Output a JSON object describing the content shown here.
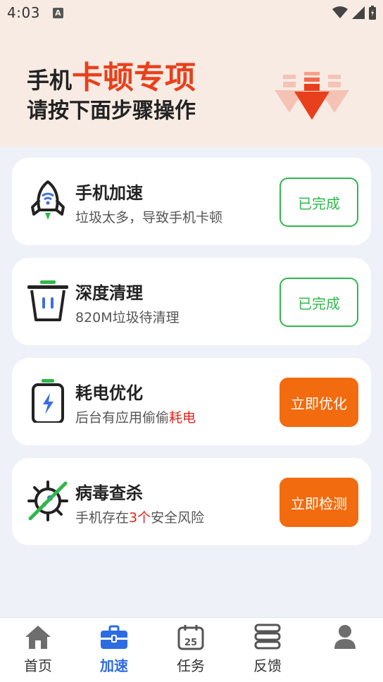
{
  "status_bar": {
    "time": "4:03",
    "notif_letter": "A"
  },
  "hero": {
    "title_prefix": "手机",
    "title_accent": "卡顿专项",
    "subtitle": "请按下面步骤操作"
  },
  "cards": [
    {
      "title": "手机加速",
      "sub_parts": [
        "垃圾太多，导致手机卡顿"
      ],
      "button": "已完成",
      "button_state": "done",
      "icon": "rocket-icon"
    },
    {
      "title": "深度清理",
      "sub_parts": [
        "820M垃圾待清理"
      ],
      "button": "已完成",
      "button_state": "done",
      "icon": "trash-icon"
    },
    {
      "title": "耗电优化",
      "sub_parts": [
        "后台有应用偷偷",
        "耗电"
      ],
      "button": "立即优化",
      "button_state": "action",
      "icon": "battery-icon"
    },
    {
      "title": "病毒查杀",
      "sub_parts": [
        "手机存在",
        "3个",
        "安全风险"
      ],
      "button": "立即检测",
      "button_state": "action",
      "icon": "virus-icon"
    }
  ],
  "tabbar": {
    "items": [
      {
        "label": "首页",
        "icon": "home-icon"
      },
      {
        "label": "加速",
        "icon": "toolbox-icon",
        "active": true
      },
      {
        "label": "任务",
        "icon": "calendar-icon",
        "calendar_day": "25"
      },
      {
        "label": "反馈",
        "icon": "server-icon"
      },
      {
        "label": "",
        "icon": "user-icon"
      }
    ]
  },
  "colors": {
    "accent_red": "#e8401c",
    "done_green": "#2fb84a",
    "action_orange": "#f26b0f",
    "active_blue": "#2d6be2"
  }
}
